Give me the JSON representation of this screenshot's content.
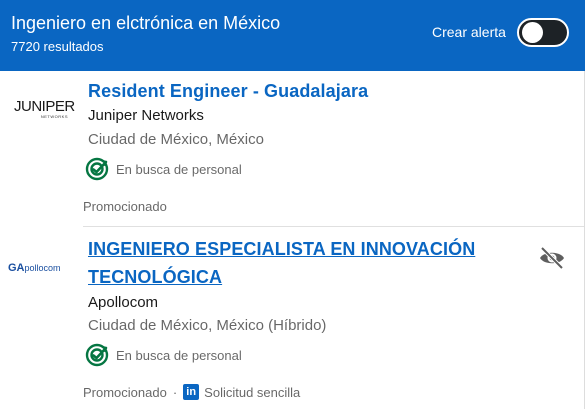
{
  "header": {
    "title": "Ingeniero en elctrónica en México",
    "results": "7720 resultados",
    "alert_label": "Crear alerta",
    "alert_enabled": false
  },
  "jobs": [
    {
      "title": "Resident Engineer - Guadalajara",
      "company": "Juniper Networks",
      "location": "Ciudad de México, México",
      "hiring_label": "En busca de personal",
      "footer": "Promocionado",
      "logo_text": "JUNIPER",
      "logo_subtext": "NETWORKS",
      "logo_icon": "juniper-logo"
    },
    {
      "title": "INGENIERO ESPECIALISTA EN INNOVACIÓN TECNOLÓGICA",
      "company": "Apollocom",
      "location": "Ciudad de México, México (Híbrido)",
      "hiring_label": "En busca de personal",
      "footer": "Promocionado",
      "separator": "·",
      "easy_apply_icon": "in",
      "easy_apply": "Solicitud sencilla",
      "logo_mark": "GA",
      "logo_text": "pollocom",
      "logo_icon": "apollocom-logo",
      "hide_icon": "eye-slash-icon"
    }
  ],
  "colors": {
    "header_bg": "#0a66c2",
    "link": "#0a66c2",
    "hiring_green": "#057642"
  }
}
